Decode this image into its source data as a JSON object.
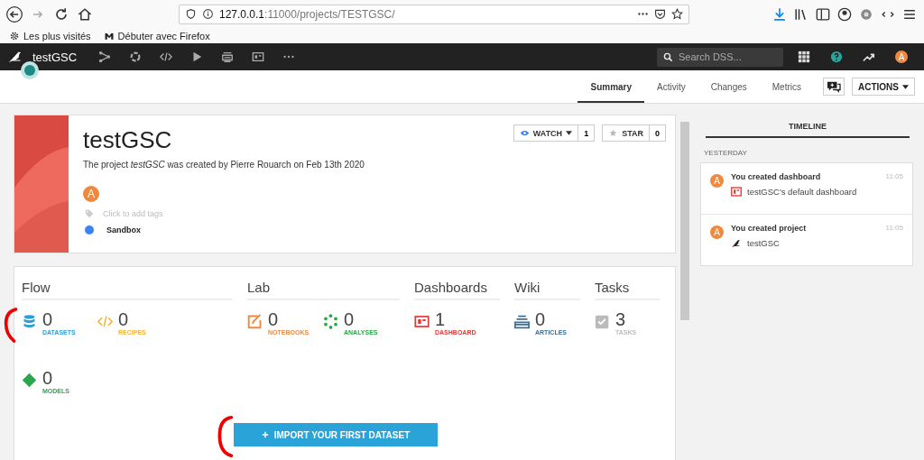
{
  "browser": {
    "url_host": "127.0.0.1",
    "url_rest": ":11000/projects/TESTGSC/",
    "bookmarks": [
      {
        "kind": "gear",
        "label": "Les plus visités"
      },
      {
        "kind": "m",
        "label": "Débuter avec Firefox"
      }
    ]
  },
  "app_nav": {
    "project": "testGSC",
    "search_placeholder": "Search DSS...",
    "user_initial": "A"
  },
  "tabs": [
    {
      "label": "Summary",
      "selected": true
    },
    {
      "label": "Activity",
      "selected": false
    },
    {
      "label": "Changes",
      "selected": false
    },
    {
      "label": "Metrics",
      "selected": false
    }
  ],
  "actions": "ACTIONS",
  "project": {
    "name": "testGSC",
    "description": "The project *testGSC* was created by Pierre Rouarch on Feb 13th 2020",
    "watch": "WATCH",
    "watch_count": "1",
    "star": "STAR",
    "star_count": "0",
    "owner_initial": "A",
    "tags_placeholder": "Click to add tags",
    "status": {
      "label": "Sandbox",
      "color": "#3b82f6"
    }
  },
  "sections": [
    {
      "title": "Flow",
      "items": [
        {
          "kind": "datasets",
          "count": "0",
          "label": "DATASETS",
          "color": "#2a9fd6"
        },
        {
          "kind": "recipes",
          "count": "0",
          "label": "RECIPES",
          "color": "#f5b335"
        },
        {
          "kind": "models",
          "count": "0",
          "label": "MODELS",
          "color": "#2ea44f"
        }
      ]
    },
    {
      "title": "Lab",
      "items": [
        {
          "kind": "notebooks",
          "count": "0",
          "label": "NOTEBOOKS",
          "color": "#f0883e"
        },
        {
          "kind": "analyses",
          "count": "0",
          "label": "ANALYSES",
          "color": "#28a745"
        }
      ]
    },
    {
      "title": "Dashboards",
      "items": [
        {
          "kind": "dashboard",
          "count": "1",
          "label": "DASHBOARD",
          "color": "#e53935"
        }
      ]
    },
    {
      "title": "Wiki",
      "items": [
        {
          "kind": "articles",
          "count": "0",
          "label": "ARTICLES",
          "color": "#3f6f94"
        }
      ]
    },
    {
      "title": "Tasks",
      "items": [
        {
          "kind": "tasks",
          "count": "3",
          "label": "TASKS",
          "color": "#bbbbbb"
        }
      ]
    }
  ],
  "import_button": "IMPORT YOUR FIRST DATASET",
  "timeline": {
    "title": "TIMELINE",
    "day": "YESTERDAY",
    "events": [
      {
        "kind": "dashboard",
        "initial": "A",
        "action": "You created dashboard",
        "object": "testGSC's default dashboard",
        "time": "11:05"
      },
      {
        "kind": "project",
        "initial": "A",
        "action": "You created project",
        "object": "testGSC",
        "time": "11:05"
      }
    ]
  }
}
